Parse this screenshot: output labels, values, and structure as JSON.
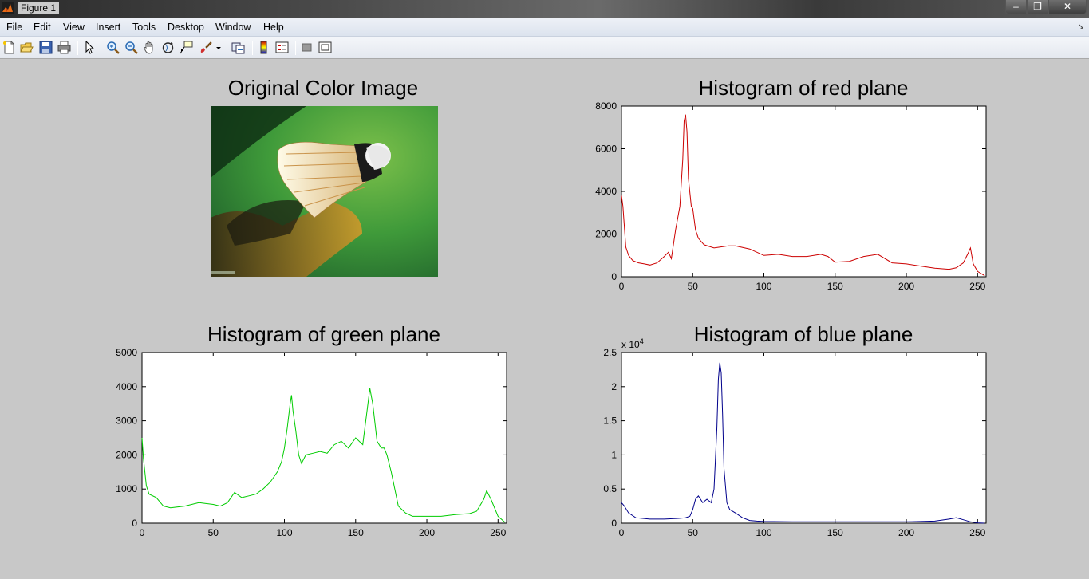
{
  "window": {
    "title": "Figure 1"
  },
  "menu": [
    "File",
    "Edit",
    "View",
    "Insert",
    "Tools",
    "Desktop",
    "Window",
    "Help"
  ],
  "toolbar": [
    "new-figure",
    "open-file",
    "save",
    "print",
    "edit-plot",
    "zoom-in",
    "zoom-out",
    "pan",
    "rotate-3d",
    "data-cursor",
    "brush",
    "link-plot",
    "colorbar",
    "legend",
    "hide-plot-tools",
    "show-plot-tools"
  ],
  "titles": {
    "image": "Original Color Image",
    "red": "Histogram of red plane",
    "green": "Histogram of green plane",
    "blue": "Histogram of blue plane"
  },
  "chart_data": [
    {
      "type": "line",
      "title": "Histogram of red plane",
      "color": "#cc0000",
      "xlim": [
        0,
        256
      ],
      "ylim": [
        0,
        8000
      ],
      "xticks": [
        0,
        50,
        100,
        150,
        200,
        250
      ],
      "yticks": [
        0,
        2000,
        4000,
        6000,
        8000
      ],
      "yticklabels": [
        "0",
        "2000",
        "4000",
        "6000",
        "8000"
      ],
      "x": [
        0,
        1,
        3,
        5,
        8,
        12,
        16,
        20,
        25,
        30,
        33,
        35,
        38,
        41,
        43,
        44,
        45,
        46,
        47,
        49,
        50,
        52,
        54,
        58,
        65,
        75,
        80,
        90,
        100,
        110,
        120,
        130,
        140,
        145,
        150,
        160,
        170,
        180,
        190,
        200,
        210,
        220,
        230,
        235,
        240,
        243,
        245,
        247,
        250,
        255
      ],
      "y": [
        3800,
        3300,
        1400,
        1000,
        750,
        650,
        600,
        550,
        650,
        950,
        1150,
        850,
        2200,
        3300,
        5500,
        7300,
        7600,
        6800,
        4600,
        3300,
        3200,
        2200,
        1800,
        1500,
        1350,
        1450,
        1450,
        1300,
        1000,
        1050,
        950,
        950,
        1050,
        950,
        680,
        720,
        950,
        1050,
        650,
        600,
        500,
        400,
        350,
        420,
        650,
        1050,
        1350,
        600,
        250,
        50
      ]
    },
    {
      "type": "line",
      "title": "Histogram of green plane",
      "color": "#00cc00",
      "xlim": [
        0,
        256
      ],
      "ylim": [
        0,
        5000
      ],
      "xticks": [
        0,
        50,
        100,
        150,
        200,
        250
      ],
      "yticks": [
        0,
        1000,
        2000,
        3000,
        4000,
        5000
      ],
      "yticklabels": [
        "0",
        "1000",
        "2000",
        "3000",
        "4000",
        "5000"
      ],
      "x": [
        0,
        1,
        3,
        5,
        10,
        15,
        20,
        30,
        40,
        50,
        55,
        60,
        65,
        70,
        75,
        80,
        85,
        90,
        95,
        98,
        100,
        102,
        104,
        105,
        106,
        108,
        110,
        112,
        115,
        120,
        125,
        130,
        135,
        140,
        145,
        150,
        155,
        158,
        160,
        162,
        165,
        168,
        170,
        172,
        175,
        180,
        185,
        190,
        200,
        210,
        220,
        230,
        235,
        240,
        242,
        245,
        250,
        255
      ],
      "y": [
        2500,
        1900,
        1100,
        850,
        750,
        500,
        450,
        500,
        600,
        550,
        500,
        600,
        900,
        750,
        800,
        850,
        1000,
        1200,
        1500,
        1800,
        2200,
        2800,
        3500,
        3750,
        3300,
        2700,
        2000,
        1750,
        2000,
        2050,
        2100,
        2050,
        2300,
        2400,
        2200,
        2500,
        2300,
        3300,
        3950,
        3500,
        2400,
        2200,
        2200,
        2000,
        1500,
        500,
        300,
        200,
        200,
        200,
        250,
        280,
        350,
        700,
        950,
        700,
        200,
        20
      ]
    },
    {
      "type": "line",
      "title": "Histogram of blue plane",
      "color": "#00008b",
      "xlim": [
        0,
        256
      ],
      "ylim": [
        0,
        25000
      ],
      "xticks": [
        0,
        50,
        100,
        150,
        200,
        250
      ],
      "yticks": [
        0,
        5000,
        10000,
        15000,
        20000,
        25000
      ],
      "yticklabels": [
        "0",
        "0.5",
        "1",
        "1.5",
        "2",
        "2.5"
      ],
      "yexponent": "x 10",
      "yexponent_power": "4",
      "x": [
        0,
        2,
        5,
        10,
        20,
        30,
        40,
        45,
        48,
        50,
        52,
        54,
        57,
        60,
        63,
        65,
        67,
        68,
        69,
        70,
        71,
        72,
        74,
        76,
        80,
        85,
        90,
        95,
        100,
        120,
        150,
        180,
        200,
        220,
        230,
        235,
        240,
        245,
        250,
        255
      ],
      "y": [
        3000,
        2500,
        1500,
        800,
        600,
        600,
        700,
        800,
        1000,
        2000,
        3500,
        4000,
        3000,
        3500,
        3000,
        5000,
        14000,
        21000,
        23500,
        22000,
        16000,
        8000,
        3000,
        2000,
        1500,
        800,
        400,
        300,
        250,
        200,
        200,
        200,
        200,
        300,
        600,
        800,
        500,
        200,
        50,
        0
      ]
    }
  ]
}
